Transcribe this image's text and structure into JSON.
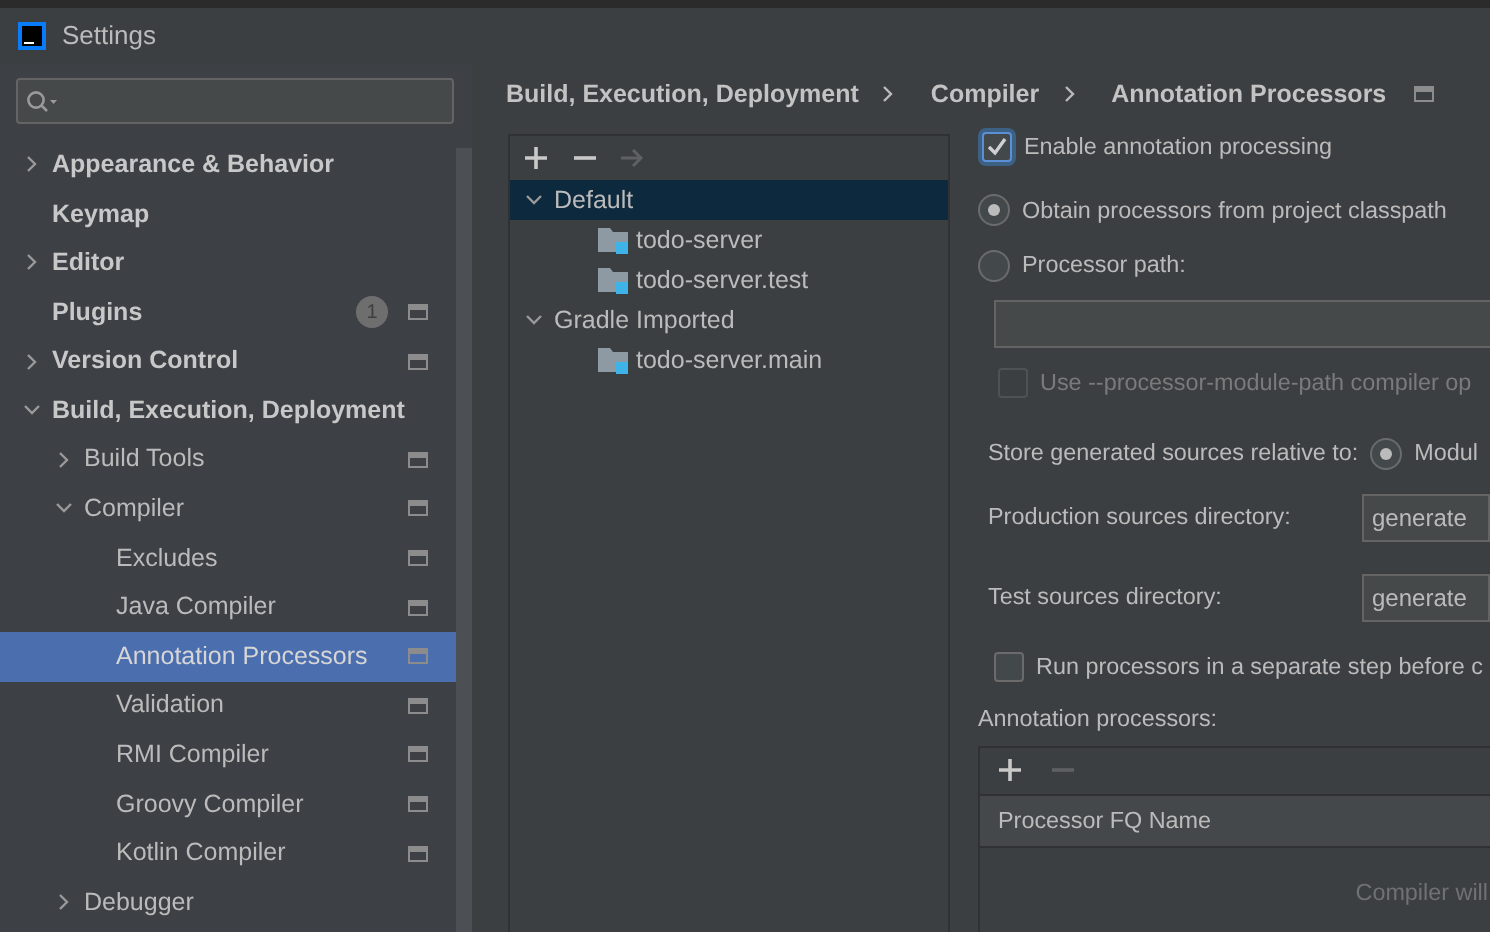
{
  "window": {
    "title": "Settings"
  },
  "sidebar": {
    "items": [
      {
        "label": "Appearance & Behavior",
        "expanded": false,
        "selected": false
      },
      {
        "label": "Keymap",
        "selected": false
      },
      {
        "label": "Editor",
        "expanded": false,
        "selected": false
      },
      {
        "label": "Plugins",
        "selected": false,
        "project_level": true,
        "badge": "1"
      },
      {
        "label": "Version Control",
        "expanded": false,
        "selected": false,
        "project_level": true
      },
      {
        "label": "Build, Execution, Deployment",
        "expanded": true,
        "selected": false,
        "children": [
          {
            "label": "Build Tools",
            "expanded": false,
            "selected": false,
            "project_level": true
          },
          {
            "label": "Compiler",
            "expanded": true,
            "selected": false,
            "project_level": true,
            "children": [
              {
                "label": "Excludes",
                "selected": false,
                "project_level": true
              },
              {
                "label": "Java Compiler",
                "selected": false,
                "project_level": true
              },
              {
                "label": "Annotation Processors",
                "selected": true,
                "project_level": true
              },
              {
                "label": "Validation",
                "selected": false,
                "project_level": true
              },
              {
                "label": "RMI Compiler",
                "selected": false,
                "project_level": true
              },
              {
                "label": "Groovy Compiler",
                "selected": false,
                "project_level": true
              },
              {
                "label": "Kotlin Compiler",
                "selected": false,
                "project_level": true
              }
            ]
          },
          {
            "label": "Debugger",
            "expanded": false,
            "selected": false
          }
        ]
      }
    ]
  },
  "breadcrumb": {
    "items": [
      "Build, Execution, Deployment",
      "Compiler",
      "Annotation Processors"
    ],
    "project_level": true
  },
  "profiles": {
    "toolbar": [
      {
        "kind": "add",
        "disabled": false
      },
      {
        "kind": "remove",
        "disabled": false
      },
      {
        "kind": "move",
        "disabled": true
      }
    ],
    "tree": [
      {
        "label": "Default",
        "expanded": true,
        "selected": true,
        "children": [
          {
            "label": "todo-server",
            "selected": false
          },
          {
            "label": "todo-server.test",
            "selected": false
          }
        ]
      },
      {
        "label": "Gradle Imported",
        "expanded": true,
        "selected": false,
        "children": [
          {
            "label": "todo-server.main",
            "selected": false
          }
        ]
      }
    ]
  },
  "options": {
    "enable": {
      "label": "Enable annotation processing",
      "checked": true
    },
    "source": [
      {
        "label": "Obtain processors from project classpath",
        "selected": true
      },
      {
        "label": "Processor path:",
        "selected": false
      }
    ],
    "module_path": {
      "label": "Use --processor-module-path compiler op",
      "checked": false,
      "disabled": true
    },
    "store": {
      "label": "Store generated sources relative to:",
      "options": [
        {
          "label": "Modul",
          "selected": true
        }
      ]
    },
    "directories": [
      {
        "label": "Production sources directory:",
        "value": "generate"
      },
      {
        "label": "Test sources directory:",
        "value": "generate"
      }
    ],
    "separate_step": {
      "label": "Run processors in a separate step before c",
      "checked": false
    },
    "processors": {
      "label": "Annotation processors:",
      "toolbar": [
        {
          "kind": "add",
          "disabled": false
        },
        {
          "kind": "remove",
          "disabled": true
        }
      ],
      "columns": [
        "Processor FQ Name"
      ],
      "empty_text": "Compiler will"
    }
  }
}
